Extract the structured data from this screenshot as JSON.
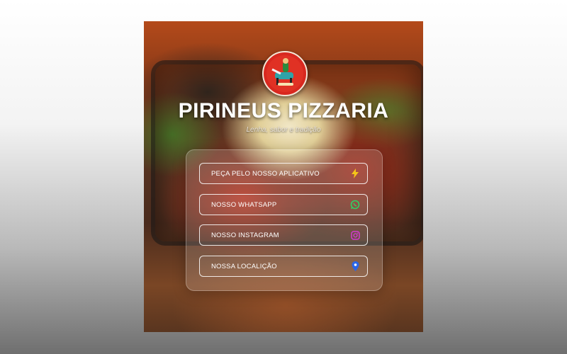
{
  "brand": {
    "title": "PIRINEUS PIZZARIA",
    "subtitle": "Lenha, sabor e tradição"
  },
  "links": [
    {
      "label": "PEÇA PELO NOSSO APLICATIVO",
      "icon": "lightning-icon",
      "color": "#f5c518"
    },
    {
      "label": "NOSSO WHATSAPP",
      "icon": "whatsapp-icon",
      "color": "#2fd163"
    },
    {
      "label": "NOSSO INSTAGRAM",
      "icon": "instagram-icon",
      "color": "#d43ad0"
    },
    {
      "label": "NOSSA LOCALIÇÃO",
      "icon": "location-pin-icon",
      "color": "#2a66e8"
    }
  ]
}
